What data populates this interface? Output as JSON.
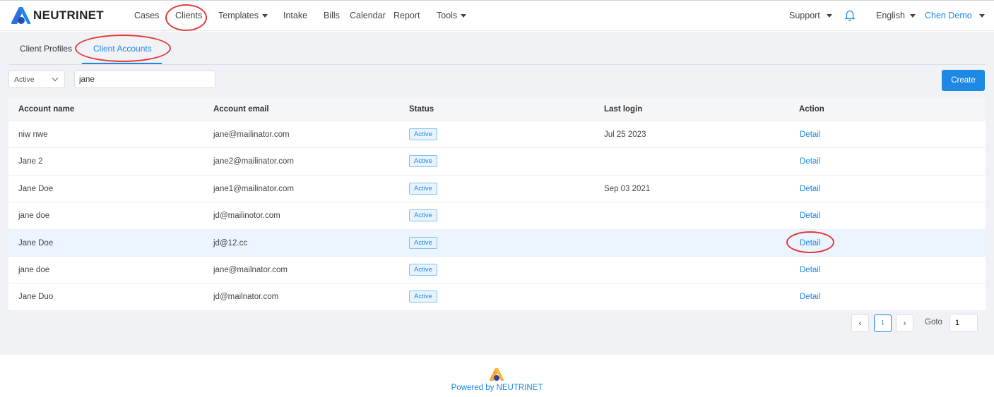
{
  "brand": {
    "name": "NEUTRINET",
    "accent": "#1e88e5"
  },
  "nav": {
    "cases": "Cases",
    "clients": "Clients",
    "templates": "Templates",
    "intake": "Intake",
    "bills": "Bills",
    "calendar": "Calendar",
    "report": "Report",
    "tools": "Tools",
    "support": "Support",
    "language": "English",
    "user": "Chen Demo"
  },
  "tabs": [
    {
      "label": "Client Profiles",
      "active": false
    },
    {
      "label": "Client Accounts",
      "active": true
    }
  ],
  "filters": {
    "status_selected": "Active",
    "search_value": "jane",
    "create_label": "Create"
  },
  "table": {
    "headers": [
      "Account name",
      "Account email",
      "Status",
      "Last login",
      "Action"
    ],
    "rows": [
      {
        "name": "niw nwe",
        "email": "jane@mailinator.com",
        "status": "Active",
        "last_login": "Jul 25 2023",
        "action": "Detail"
      },
      {
        "name": "Jane 2",
        "email": "jane2@mailinator.com",
        "status": "Active",
        "last_login": "",
        "action": "Detail"
      },
      {
        "name": "Jane Doe",
        "email": "jane1@mailinator.com",
        "status": "Active",
        "last_login": "Sep 03 2021",
        "action": "Detail"
      },
      {
        "name": "jane doe",
        "email": "jd@mailinotor.com",
        "status": "Active",
        "last_login": "",
        "action": "Detail"
      },
      {
        "name": "Jane Doe",
        "email": "jd@12.cc",
        "status": "Active",
        "last_login": "",
        "action": "Detail"
      },
      {
        "name": "jane doe",
        "email": "jane@mailnator.com",
        "status": "Active",
        "last_login": "",
        "action": "Detail"
      },
      {
        "name": "Jane Duo",
        "email": "jd@mailnator.com",
        "status": "Active",
        "last_login": "",
        "action": "Detail"
      }
    ]
  },
  "pagination": {
    "prev": "‹",
    "current_page": "1",
    "next": "›",
    "goto_label": "Goto",
    "goto_value": "1"
  },
  "footer": {
    "text": "Powered by NEUTRINET"
  }
}
